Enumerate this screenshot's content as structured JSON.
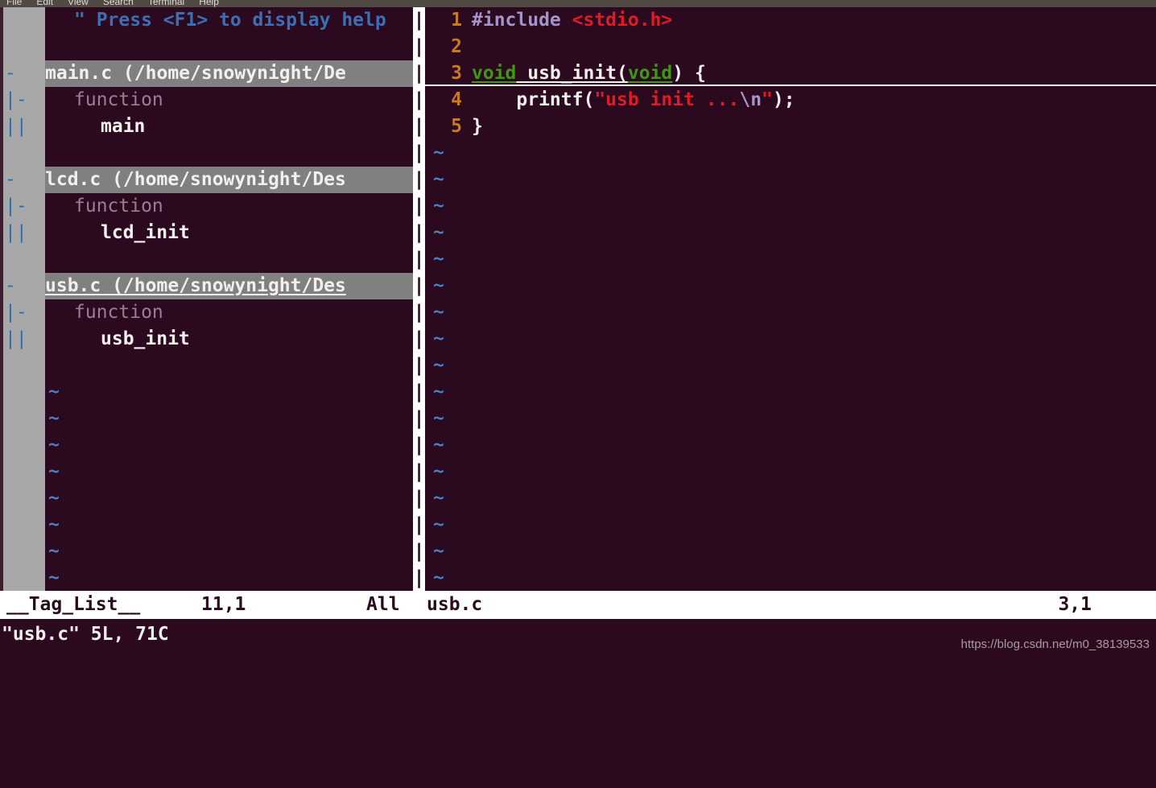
{
  "menubar": {
    "items": [
      "File",
      "Edit",
      "View",
      "Search",
      "Terminal",
      "Help"
    ]
  },
  "colors": {
    "background": "#2b0a20",
    "foldcolumn_bg": "#a8a8a8",
    "taglist_header_bg": "#808080",
    "statusline_bg": "#ffffff",
    "statusline_fg": "#2b0a20",
    "linenumber": "#c87a1e",
    "string": "#e01b24",
    "type_keyword": "#3a9a12",
    "preproc": "#a394c9",
    "tilde": "#4a7fc1",
    "tag_kind": "#9b7e95"
  },
  "taglist": {
    "rows": [
      {
        "fold": "",
        "style": "comment",
        "text": "\" Press <F1> to display help"
      },
      {
        "fold": "",
        "style": "blank",
        "text": ""
      },
      {
        "fold": "-",
        "style": "header",
        "text": "main.c (/home/snowynight/De",
        "current": false
      },
      {
        "fold": "|-",
        "style": "kind",
        "text": "function"
      },
      {
        "fold": "||",
        "style": "tag",
        "text": "main"
      },
      {
        "fold": "",
        "style": "blank",
        "text": ""
      },
      {
        "fold": "-",
        "style": "header",
        "text": "lcd.c (/home/snowynight/Des",
        "current": false
      },
      {
        "fold": "|-",
        "style": "kind",
        "text": "function"
      },
      {
        "fold": "||",
        "style": "tag",
        "text": "lcd_init"
      },
      {
        "fold": "",
        "style": "blank",
        "text": ""
      },
      {
        "fold": "-",
        "style": "header",
        "text": "usb.c (/home/snowynight/Des",
        "current": true
      },
      {
        "fold": "|-",
        "style": "kind",
        "text": "function"
      },
      {
        "fold": "||",
        "style": "tag",
        "text": "usb_init"
      },
      {
        "fold": "",
        "style": "blank",
        "text": ""
      },
      {
        "fold": "",
        "style": "tilde",
        "text": "~"
      },
      {
        "fold": "",
        "style": "tilde",
        "text": "~"
      },
      {
        "fold": "",
        "style": "tilde",
        "text": "~"
      },
      {
        "fold": "",
        "style": "tilde",
        "text": "~"
      },
      {
        "fold": "",
        "style": "tilde",
        "text": "~"
      },
      {
        "fold": "",
        "style": "tilde",
        "text": "~"
      },
      {
        "fold": "",
        "style": "tilde",
        "text": "~"
      },
      {
        "fold": "",
        "style": "tilde",
        "text": "~"
      }
    ]
  },
  "vsplit": {
    "glyph": "|",
    "count": 22
  },
  "editor": {
    "filename": "usb.c",
    "lines": [
      {
        "number": "1",
        "cursorline": false,
        "spans": [
          {
            "text": "#include ",
            "style": "s-pre"
          },
          {
            "text": "<stdio.h>",
            "style": "s-str"
          }
        ]
      },
      {
        "number": "2",
        "cursorline": false,
        "spans": []
      },
      {
        "number": "3",
        "cursorline": true,
        "spans": [
          {
            "text": "void",
            "style": "s-type s-under"
          },
          {
            "text": " usb_init(",
            "style": "s-plain s-under"
          },
          {
            "text": "void",
            "style": "s-type s-under"
          },
          {
            "text": ") {",
            "style": "s-plain"
          }
        ]
      },
      {
        "number": "4",
        "cursorline": false,
        "spans": [
          {
            "text": "    printf(",
            "style": "s-plain"
          },
          {
            "text": "\"usb init ...",
            "style": "s-str"
          },
          {
            "text": "\\n",
            "style": "s-esc"
          },
          {
            "text": "\"",
            "style": "s-str"
          },
          {
            "text": ");",
            "style": "s-plain"
          }
        ]
      },
      {
        "number": "5",
        "cursorline": false,
        "spans": [
          {
            "text": "}",
            "style": "s-plain"
          }
        ]
      }
    ],
    "empty_tilde": "~",
    "empty_line_count": 17
  },
  "statusline": {
    "taglist_name": "__Tag_List__",
    "taglist_position": "11,1",
    "taglist_percent": "All",
    "editor_name": "usb.c",
    "editor_position": "3,1"
  },
  "cmdline": {
    "message": "\"usb.c\" 5L, 71C"
  },
  "watermark": {
    "text": "https://blog.csdn.net/m0_38139533"
  }
}
